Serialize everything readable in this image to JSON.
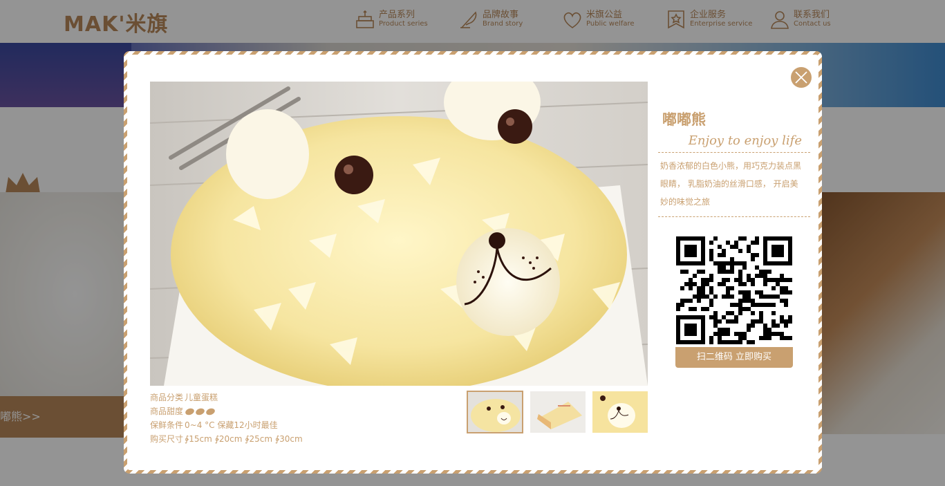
{
  "header": {
    "logo_text": "MAK'米旗",
    "nav": [
      {
        "cn": "产品系列",
        "en": "Product series",
        "icon": "cake-icon"
      },
      {
        "cn": "品牌故事",
        "en": "Brand story",
        "icon": "quill-icon"
      },
      {
        "cn": "米旗公益",
        "en": "Public welfare",
        "icon": "heart-hands-icon"
      },
      {
        "cn": "企业服务",
        "en": "Enterprise service",
        "icon": "badge-icon"
      },
      {
        "cn": "联系我们",
        "en": "Contact us",
        "icon": "user-icon"
      }
    ]
  },
  "background": {
    "left_bar_text": "嘟熊>>"
  },
  "modal": {
    "product_name": "嘟嘟熊",
    "tagline": "Enjoy to enjoy life",
    "description": "奶香浓郁的白色小熊，用巧克力装点黑眼睛， 乳脂奶油的丝滑口感， 开启美妙的味觉之旅",
    "qr_button": "扫二维码 立即购买",
    "specs": {
      "category_label": "商品分类",
      "category": "儿童蛋糕",
      "sweetness_label": "商品甜度",
      "sweetness_level": 3,
      "storage_label": "保鲜条件",
      "storage": "0~4 °C 保藏12小时最佳",
      "size_label": "购买尺寸",
      "sizes": "∲15cm ∲20cm ∲25cm ∲30cm"
    },
    "thumbnails": [
      {
        "name": "whole-bear-cake",
        "active": true
      },
      {
        "name": "cake-slice",
        "active": false
      },
      {
        "name": "bear-face-closeup",
        "active": false
      }
    ]
  },
  "colors": {
    "accent": "#c9a070",
    "brand": "#b8895a",
    "overlay": "rgba(0,0,0,0.42)"
  }
}
